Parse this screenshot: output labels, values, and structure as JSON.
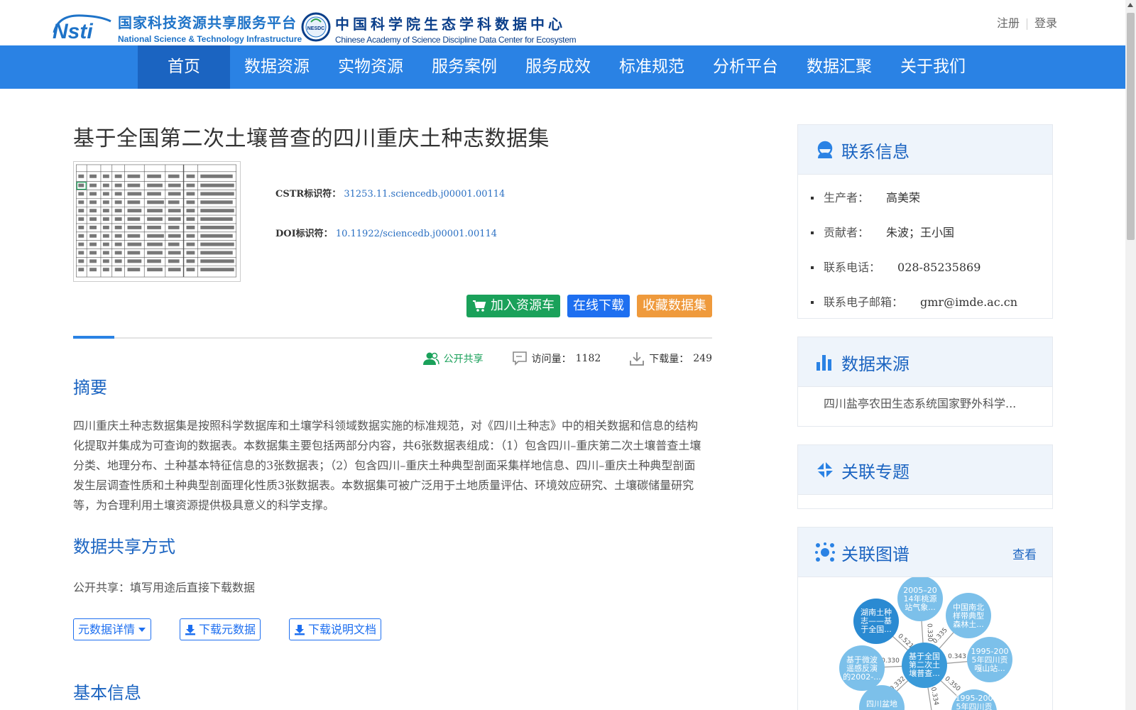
{
  "header": {
    "logo_nsti": {
      "cn": "国家科技资源共享服务平台",
      "en": "National Science & Technology Infrastructure"
    },
    "logo_nesdc": {
      "badge": "NESDC",
      "cn": "中国科学院生态学科数据中心",
      "en": "Chinese Academy of Science Discipline Data Center for Ecosystem"
    },
    "register": "注册",
    "login": "登录"
  },
  "nav": {
    "items": [
      "首页",
      "数据资源",
      "实物资源",
      "服务案例",
      "服务成效",
      "标准规范",
      "分析平台",
      "数据汇聚",
      "关于我们"
    ],
    "active_index": 0,
    "color": "#2a82e4",
    "active_color": "#1b64c1"
  },
  "dataset": {
    "title": "基于全国第二次土壤普查的四川重庆土种志数据集",
    "cstr_label": "CSTR标识符：",
    "cstr_value": "31253.11.sciencedb.j00001.00114",
    "doi_label": "DOI标识符：",
    "doi_value": "10.11922/sciencedb.j00001.00114",
    "btn_cart": "加入资源车",
    "btn_download": "在线下载",
    "btn_collect": "收藏数据集",
    "share_label": "公开共享",
    "visits_label": "访问量：",
    "visits": "1182",
    "downloads_label": "下载量：",
    "downloads": "249"
  },
  "abstract": {
    "heading": "摘要",
    "text": "四川重庆土种志数据集是按照科学数据库和土壤学科领域数据实施的标准规范，对《四川土种志》中的相关数据和信息的结构化提取并集成为可查询的数据表。本数据集主要包括两部分内容，共6张数据表组成：（1）包含四川–重庆第二次土壤普查土壤分类、地理分布、土种基本特征信息的3张数据表；（2）包含四川–重庆土种典型剖面采集样地信息、四川–重庆土种典型剖面发生层调查性质和土种典型剖面理化性质3张数据表。本数据集可被广泛用于土地质量评估、环境效应研究、土壤碳储量研究等，为合理利用土壤资源提供极具意义的科学支撑。"
  },
  "sharing": {
    "heading": "数据共享方式",
    "text": "公开共享：填写用途后直接下载数据",
    "btn_meta": "元数据详情",
    "btn_meta_download": "下载元数据",
    "btn_doc_download": "下载说明文档"
  },
  "basic_info": {
    "heading": "基本信息"
  },
  "sidebar": {
    "contact": {
      "title": "联系信息",
      "items": [
        {
          "label": "生产者：",
          "value": "高美荣"
        },
        {
          "label": "贡献者：",
          "value": "朱波；王小国"
        },
        {
          "label": "联系电话：",
          "value": "028-85235869"
        },
        {
          "label": "联系电子邮箱：",
          "value": "gmr@imde.ac.cn"
        }
      ]
    },
    "source": {
      "title": "数据来源",
      "text": "四川盐亭农田生态系统国家野外科学..."
    },
    "topics": {
      "title": "关联专题"
    },
    "graph": {
      "title": "关联图谱",
      "more": "查看",
      "nodes": [
        {
          "label": [
            "基于全国",
            "第二次土",
            "壤普查..."
          ],
          "dark": true
        },
        {
          "label": [
            "湖南土种",
            "志——基",
            "于全国..."
          ],
          "dark": true
        },
        {
          "label": [
            "2005–20",
            "14年桃源",
            "站气象..."
          ],
          "dark": false
        },
        {
          "label": [
            "中国南北",
            "样带典型",
            "森林土..."
          ],
          "dark": false
        },
        {
          "label": [
            "1995-200",
            "5年四川贡",
            "嘎山站..."
          ],
          "dark": false
        },
        {
          "label": [
            "基于微波",
            "遥感反演",
            "的2002-..."
          ],
          "dark": false
        },
        {
          "label": [
            "1995-200",
            "5年四川贡",
            ""
          ],
          "dark": false
        },
        {
          "label": [
            "四川盆地",
            "",
            ""
          ],
          "dark": false
        }
      ],
      "edge_labels": [
        "0.521",
        "0.330",
        "0.335",
        "0.343",
        "0.330",
        "0.350",
        "0.332",
        "0.334"
      ]
    }
  }
}
